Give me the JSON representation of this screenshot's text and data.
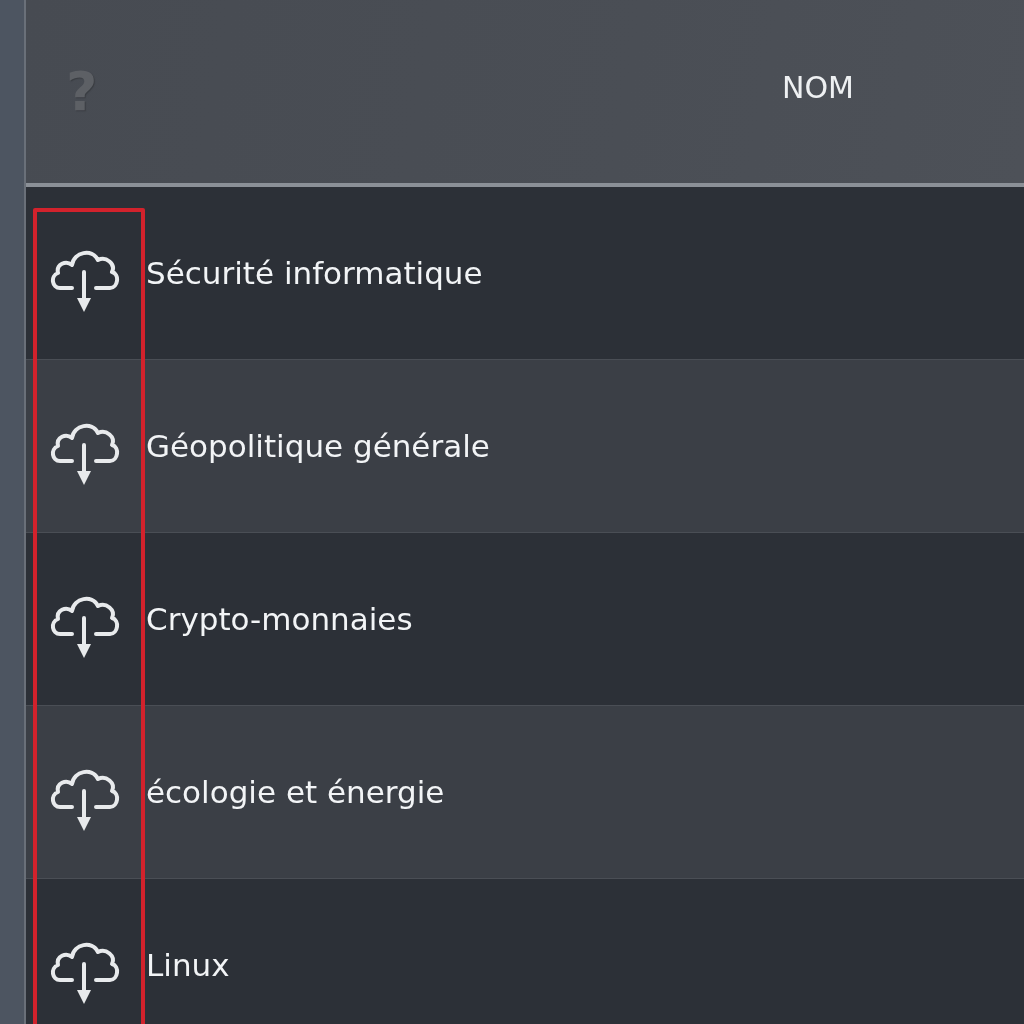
{
  "header": {
    "help_mark": "?",
    "column_title": "NOM"
  },
  "icon_column_highlighted": true,
  "rows": [
    {
      "name": "Sécurité informatique"
    },
    {
      "name": "Géopolitique générale"
    },
    {
      "name": "Crypto-monnaies"
    },
    {
      "name": "écologie et énergie"
    },
    {
      "name": "Linux"
    }
  ]
}
